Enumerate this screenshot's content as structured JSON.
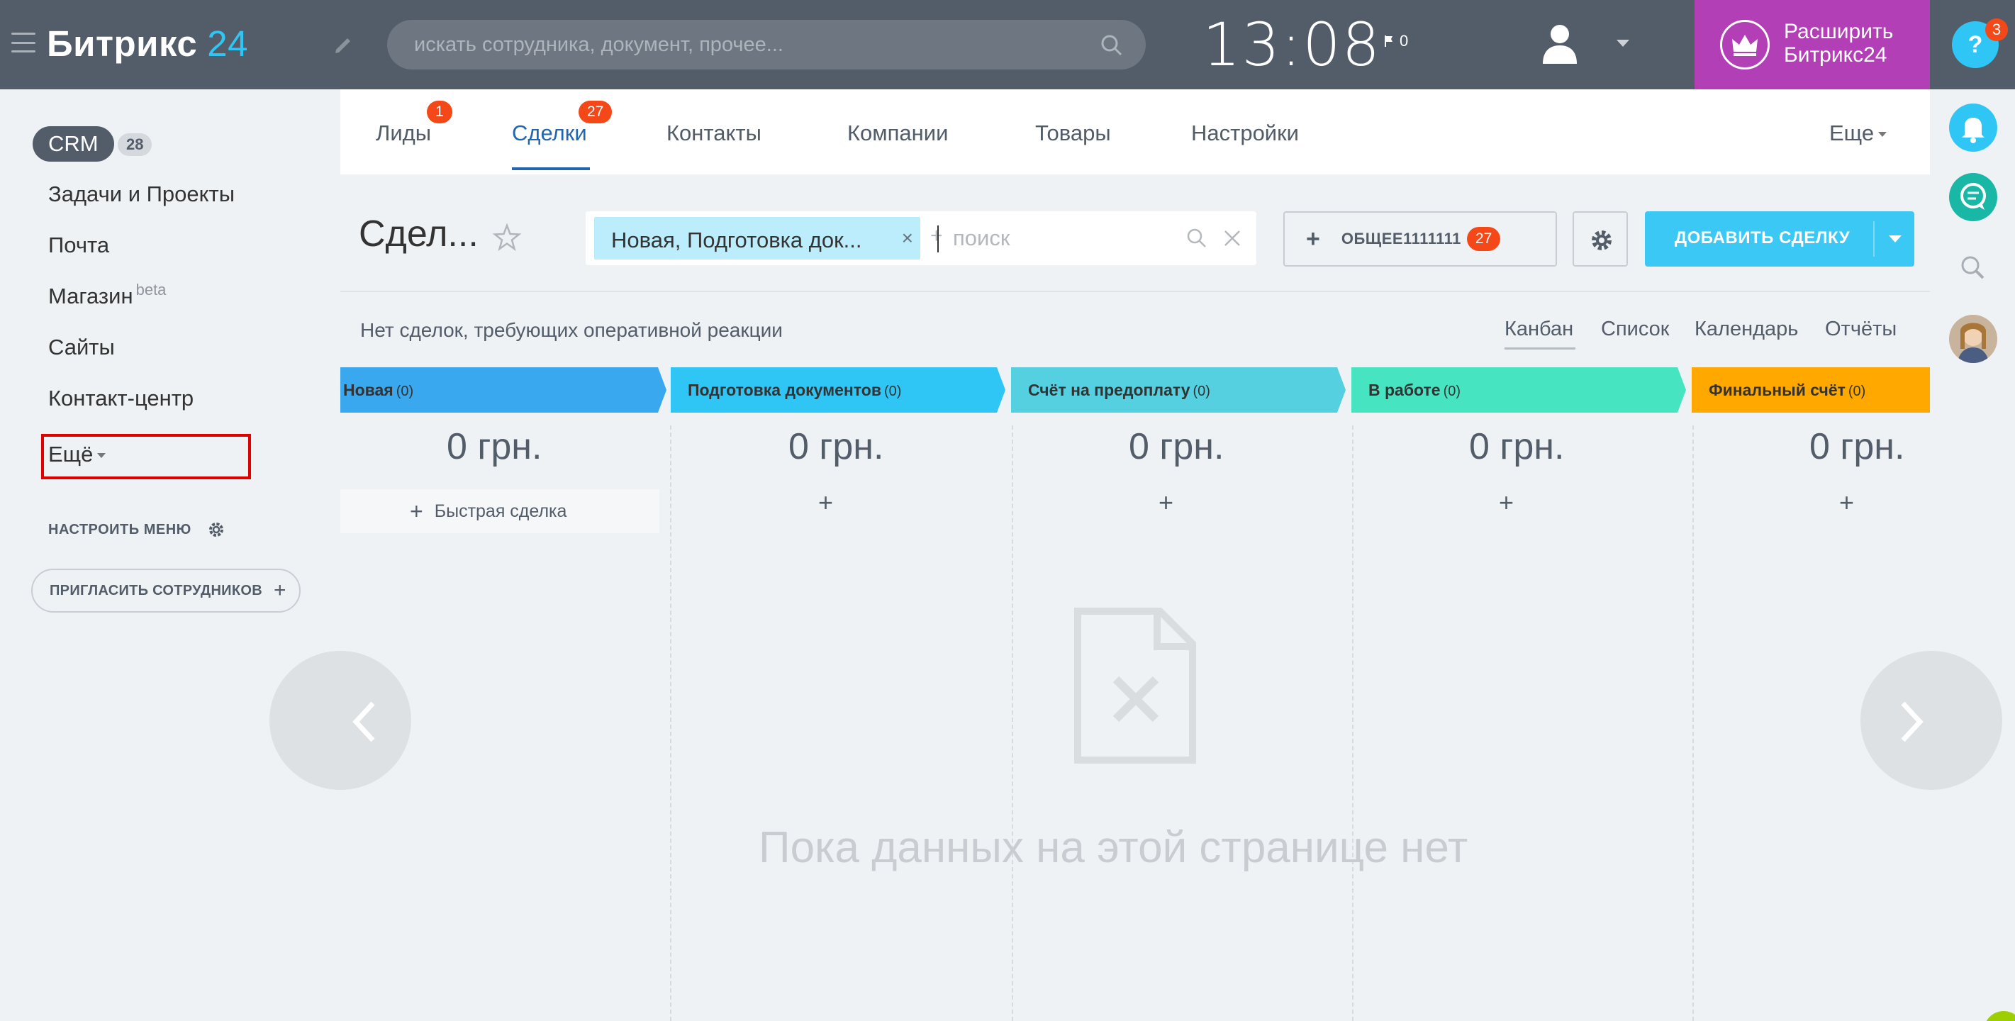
{
  "app": {
    "logo_text": "Битрикс",
    "logo_num": "24",
    "search_placeholder": "искать сотрудника, документ, прочее...",
    "clock": "13:08",
    "flag_count": "0",
    "upgrade_line1": "Расширить",
    "upgrade_line2": "Битрикс24",
    "help_badge": "3",
    "help_label": "?"
  },
  "leftmenu": {
    "crm_label": "CRM",
    "crm_count": "28",
    "items": [
      {
        "label": "Задачи и Проекты"
      },
      {
        "label": "Почта"
      },
      {
        "label": "Магазин",
        "sup": "beta"
      },
      {
        "label": "Сайты"
      },
      {
        "label": "Контакт-центр"
      }
    ],
    "more_label": "Ещё",
    "setup_label": "НАСТРОИТЬ МЕНЮ",
    "invite_label": "ПРИГЛАСИТЬ СОТРУДНИКОВ"
  },
  "tabs": {
    "items": [
      {
        "label": "Лиды",
        "badge": "1"
      },
      {
        "label": "Сделки",
        "badge": "27"
      },
      {
        "label": "Контакты"
      },
      {
        "label": "Компании"
      },
      {
        "label": "Товары"
      },
      {
        "label": "Настройки"
      }
    ],
    "more_label": "Еще"
  },
  "toolbar": {
    "page_title": "Сдел...",
    "filter_tag": "Новая, Подготовка док...",
    "filter_plus": "+",
    "filter_placeholder": "поиск",
    "counter_label": "ОБЩЕЕ1111111",
    "counter_badge": "27",
    "add_label": "ДОБАВИТЬ СДЕЛКУ"
  },
  "subbar": {
    "notice": "Нет сделок, требующих оперативной реакции",
    "views": [
      "Канбан",
      "Список",
      "Календарь",
      "Отчёты"
    ],
    "active_view": "Канбан"
  },
  "kanban": {
    "stages": [
      {
        "name": "Новая",
        "count": "(0)",
        "sum": "0 грн.",
        "color": "#39a8ef"
      },
      {
        "name": "Подготовка документов",
        "count": "(0)",
        "sum": "0 грн.",
        "color": "#2fc6f6"
      },
      {
        "name": "Счёт на предоплату",
        "count": "(0)",
        "sum": "0 грн.",
        "color": "#55d0e0"
      },
      {
        "name": "В работе",
        "count": "(0)",
        "sum": "0 грн.",
        "color": "#47e4c2"
      },
      {
        "name": "Финальный счёт",
        "count": "(0)",
        "sum": "0 грн.",
        "color": "#ffa900"
      }
    ],
    "quick_deal_label": "Быстрая сделка",
    "add_symbol": "+",
    "empty_text": "Пока данных на этой странице нет"
  }
}
